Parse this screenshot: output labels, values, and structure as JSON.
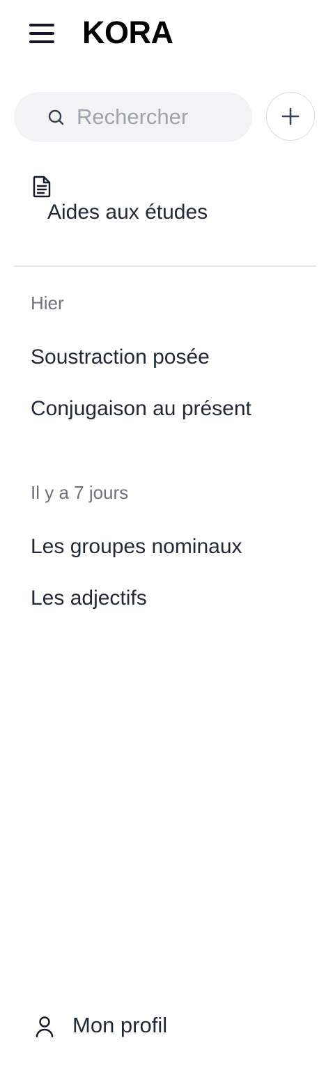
{
  "header": {
    "menu_icon": "hamburger-menu-icon",
    "logo": "KORA"
  },
  "search": {
    "icon": "search-icon",
    "placeholder": "Rechercher"
  },
  "add_button": {
    "icon": "plus-icon"
  },
  "study_aids": {
    "icon": "document-icon",
    "label": "Aides aux études"
  },
  "history": {
    "sections": [
      {
        "label": "Hier",
        "items": [
          "Soustraction posée",
          "Conjugaison au présent"
        ]
      },
      {
        "label": "Il y a 7 jours",
        "items": [
          "Les groupes nominaux",
          "Les adjectifs"
        ]
      }
    ]
  },
  "profile": {
    "icon": "user-icon",
    "label": "Mon profil"
  },
  "colors": {
    "text_primary": "#1f2937",
    "text_muted": "#6b7280",
    "placeholder": "#9ca3af",
    "search_bg": "#f1f3f5",
    "divider": "#e5e7eb"
  }
}
